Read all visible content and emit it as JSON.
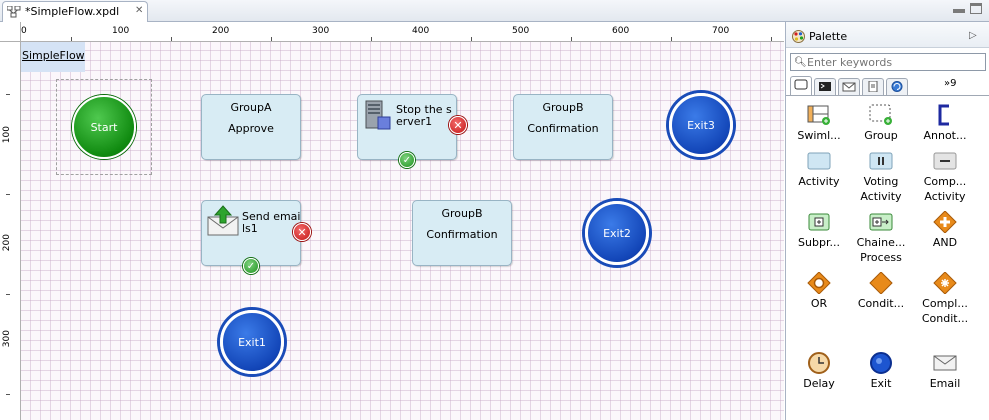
{
  "editor": {
    "tab_title": "*SimpleFlow.xpdl",
    "tab_close_glyph": "✕"
  },
  "ruler": {
    "top_labels": [
      "0",
      "100",
      "200",
      "300",
      "400",
      "500",
      "600",
      "700"
    ],
    "left_labels": [
      "100",
      "200",
      "300"
    ]
  },
  "diagram": {
    "pool_label": "SimpleFlow",
    "start_event": "Start",
    "activities": {
      "group_a": {
        "line1": "GroupA",
        "line2": "Approve"
      },
      "group_b_top": {
        "line1": "GroupB",
        "line2": "Confirmation"
      },
      "group_b_mid": {
        "line1": "GroupB",
        "line2": "Confirmation"
      }
    },
    "tasks": {
      "stop_server": {
        "line1": "Stop the s",
        "line2": "erver1"
      },
      "send_email": {
        "line1": "Send emai",
        "line2": "ls1"
      }
    },
    "end_events": {
      "exit1": "Exit1",
      "exit2": "Exit2",
      "exit3": "Exit3"
    },
    "badges": {
      "error_glyph": "✕",
      "ok_glyph": "✓"
    }
  },
  "palette": {
    "title": "Palette",
    "collapse_glyph": "▷",
    "search_placeholder": "Enter keywords",
    "more_tabs": "»9",
    "items": [
      {
        "l1": "Swiml...",
        "l2": ""
      },
      {
        "l1": "Group",
        "l2": ""
      },
      {
        "l1": "Annot...",
        "l2": ""
      },
      {
        "l1": "Activity",
        "l2": ""
      },
      {
        "l1": "Voting",
        "l2": "Activity"
      },
      {
        "l1": "Comp...",
        "l2": "Activity"
      },
      {
        "l1": "Subpr...",
        "l2": ""
      },
      {
        "l1": "Chaine...",
        "l2": "Process"
      },
      {
        "l1": "AND",
        "l2": ""
      },
      {
        "l1": "OR",
        "l2": ""
      },
      {
        "l1": "Condit...",
        "l2": ""
      },
      {
        "l1": "Compl...",
        "l2": "Condit..."
      },
      {
        "l1": "Delay",
        "l2": ""
      },
      {
        "l1": "Exit",
        "l2": ""
      },
      {
        "l1": "Email",
        "l2": ""
      }
    ]
  },
  "colors": {
    "start_green": "#108a10",
    "end_blue": "#1346b8",
    "activity_fill": "#d8ecf4",
    "gateway_orange": "#e07a10"
  }
}
